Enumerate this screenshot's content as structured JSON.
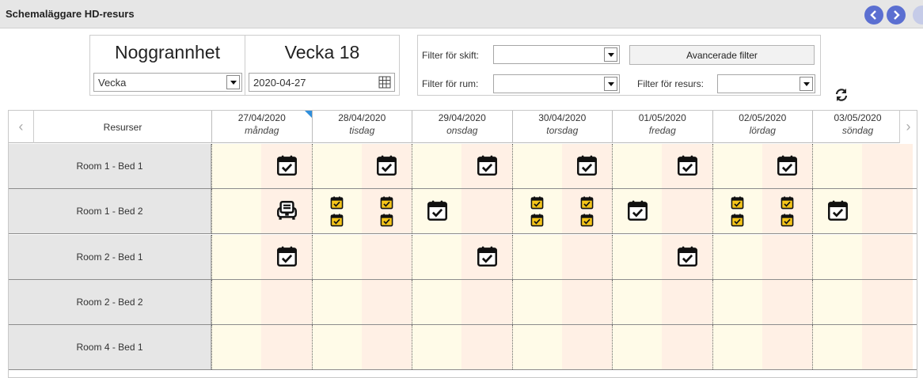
{
  "window": {
    "title": "Schemaläggare HD-resurs"
  },
  "granularity": {
    "label": "Noggrannhet",
    "value": "Vecka"
  },
  "week": {
    "label": "Vecka 18",
    "date": "2020-04-27"
  },
  "filters": {
    "shift_label": "Filter för skift:",
    "shift_value": "",
    "room_label": "Filter för rum:",
    "room_value": "",
    "advanced_label": "Avancerade filter",
    "resource_label": "Filter för resurs:",
    "resource_value": ""
  },
  "grid": {
    "resource_header": "Resurser",
    "days": [
      {
        "date": "27/04/2020",
        "weekday": "måndag"
      },
      {
        "date": "28/04/2020",
        "weekday": "tisdag"
      },
      {
        "date": "29/04/2020",
        "weekday": "onsdag"
      },
      {
        "date": "30/04/2020",
        "weekday": "torsdag"
      },
      {
        "date": "01/05/2020",
        "weekday": "fredag"
      },
      {
        "date": "02/05/2020",
        "weekday": "lördag"
      },
      {
        "date": "03/05/2020",
        "weekday": "söndag"
      }
    ],
    "rows": [
      {
        "name": "Room 1 - Bed 1"
      },
      {
        "name": "Room 1 - Bed 2"
      },
      {
        "name": "Room 2 - Bed 1"
      },
      {
        "name": "Room 2 - Bed 2"
      },
      {
        "name": "Room 4 - Bed 1"
      }
    ]
  },
  "icons": {
    "prev": "chevron-left-icon",
    "next": "chevron-right-icon",
    "date_picker": "calendar-grid-icon",
    "refresh": "refresh-icon",
    "event": "calendar-check-icon",
    "device": "dialysis-machine-icon"
  },
  "colors": {
    "accent": "#5b6fd1",
    "morning_bg": "#fffbe8",
    "afternoon_bg": "#fff0e5",
    "event_yellow": "#f5c518",
    "flag_blue": "#2f8fdc"
  }
}
